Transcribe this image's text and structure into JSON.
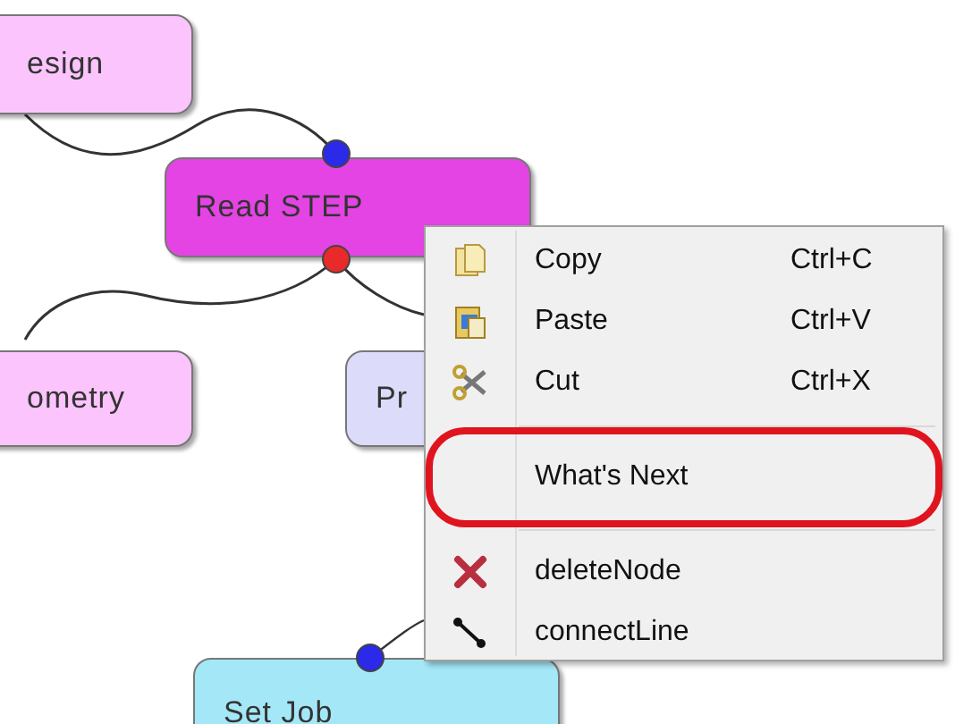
{
  "nodes": [
    {
      "label": "esign",
      "color": "#fcc4fc"
    },
    {
      "label": "Read STEP",
      "color": "#e444e4"
    },
    {
      "label": "ometry",
      "color": "#fcc4fc"
    },
    {
      "label": "Pr",
      "color": "#dcdcfa"
    },
    {
      "label": "Set Job",
      "color": "#a4e8f8"
    }
  ],
  "context_menu": {
    "items": [
      {
        "kind": "item",
        "label": "Copy",
        "shortcut": "Ctrl+C",
        "highlighted": false
      },
      {
        "kind": "item",
        "label": "Paste",
        "shortcut": "Ctrl+V",
        "highlighted": false
      },
      {
        "kind": "item",
        "label": "Cut",
        "shortcut": "Ctrl+X",
        "highlighted": false
      },
      {
        "kind": "separator"
      },
      {
        "kind": "item",
        "label": "What's Next",
        "highlighted": true
      },
      {
        "kind": "separator"
      },
      {
        "kind": "item",
        "label": "deleteNode",
        "highlighted": false
      },
      {
        "kind": "item",
        "label": "connectLine",
        "highlighted": false
      }
    ]
  }
}
